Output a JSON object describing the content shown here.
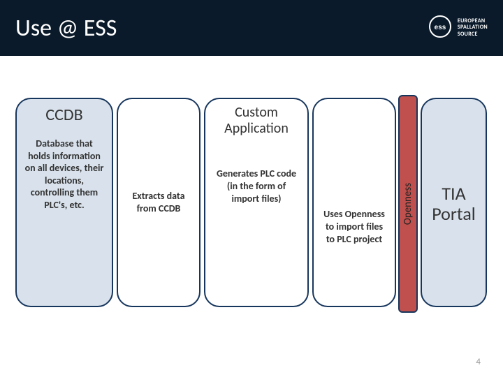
{
  "header": {
    "title": "Use @ ESS",
    "org_line1": "EUROPEAN",
    "org_line2": "SPALLATION",
    "org_line3": "SOURCE"
  },
  "nodes": {
    "ccdb": {
      "title": "CCDB",
      "body": "Database that holds information on all devices, their locations, controlling them PLC's, etc."
    },
    "extract": {
      "body": "Extracts data from CCDB"
    },
    "custom": {
      "title": "Custom Application",
      "body": "Generates PLC code (in the form of import files)"
    },
    "uses": {
      "body": "Uses Openness to import files to PLC project"
    },
    "openness": {
      "label": "Openness"
    },
    "tia": {
      "title_line1": "TIA",
      "title_line2": "Portal"
    }
  },
  "page_number": "4"
}
